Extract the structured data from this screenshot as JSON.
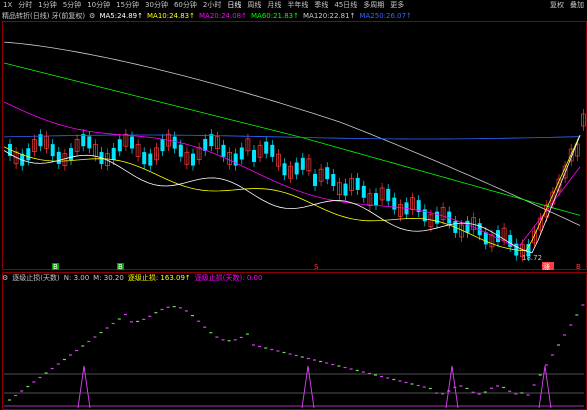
{
  "toolbar": {
    "items": [
      "1X",
      "分时",
      "1分钟",
      "5分钟",
      "10分钟",
      "15分钟",
      "30分钟",
      "60分钟",
      "2小时",
      "日线",
      "周线",
      "月线",
      "半年线",
      "季线",
      "45日线",
      "多周期",
      "更多"
    ],
    "active_index": 9,
    "right_items": [
      "复权",
      "叠加"
    ]
  },
  "main_legend": {
    "title": "精品转折(日线) 牙(前复权)",
    "ma5": "MA5:24.89↑",
    "ma10": "MA10:24.83↑",
    "ma20": "MA20:24.08↑",
    "ma60": "MA60:21.83↑",
    "ma120": "MA120:22.81↑",
    "ma250": "MA250:26.07↑"
  },
  "chart_labels": {
    "low_price": "18.72",
    "signal_buy_1": "B",
    "signal_buy_2": "B",
    "signal_s": "S",
    "signal_right_1": "涨",
    "signal_right_2": "B"
  },
  "sub_legend": {
    "title": "逐级止损(天数)",
    "n": "N: 3.00",
    "m": "M: 30.20",
    "value1": "逐级止损: 163.09↑",
    "value2": "逐级止损(天数): 0.00"
  },
  "colors": {
    "background": "#000000",
    "up_candle": "#ff3c3c",
    "down_candle": "#00e4ff",
    "ma5": "#ffffff",
    "ma10": "#ffff00",
    "ma20": "#ff00ff",
    "ma60": "#00ff00",
    "ma120": "#cccccc",
    "ma250": "#3264ff",
    "border": "#8b0000",
    "indicator_up": "#e040fb",
    "indicator_down": "#6fdc5a"
  }
}
